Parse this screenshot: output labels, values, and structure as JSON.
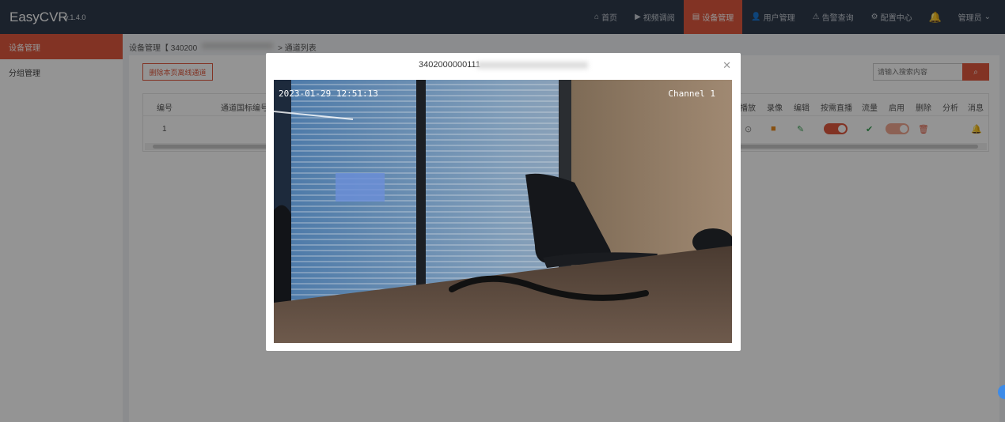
{
  "app": {
    "title": "EasyCVR",
    "version": "v.1.4.0"
  },
  "nav": {
    "items": [
      {
        "icon": "home-icon",
        "label": "首页"
      },
      {
        "icon": "play-icon",
        "label": "视频调阅"
      },
      {
        "icon": "list-icon",
        "label": "设备管理",
        "active": true
      },
      {
        "icon": "user-icon",
        "label": "用户管理"
      },
      {
        "icon": "alarm-icon",
        "label": "告警查询"
      },
      {
        "icon": "gear-icon",
        "label": "配置中心"
      }
    ],
    "user_label": "管理员"
  },
  "sidebar": {
    "items": [
      {
        "label": "设备管理",
        "active": true
      },
      {
        "label": "分组管理"
      }
    ]
  },
  "breadcrumb": {
    "part1": "设备管理【 340200",
    "part2": "> 通道列表"
  },
  "toolbar": {
    "delete_offline_label": "删除本页离线通道",
    "search_placeholder": "请输入搜索内容"
  },
  "table": {
    "headers": {
      "index": "编号",
      "channel_id": "通道国标编号",
      "play": "播放",
      "record": "录像",
      "edit": "编辑",
      "on_demand": "按需直播",
      "stream": "流量",
      "enable": "启用",
      "delete": "删除",
      "analysis": "分析",
      "message": "消息"
    },
    "rows": [
      {
        "index": "1"
      }
    ]
  },
  "modal": {
    "title": "3402000000111",
    "video": {
      "timestamp": "2023-01-29 12:51:13",
      "channel": "Channel 1"
    }
  },
  "colors": {
    "accent": "#e0593f",
    "topbar": "#2f3c4c"
  }
}
